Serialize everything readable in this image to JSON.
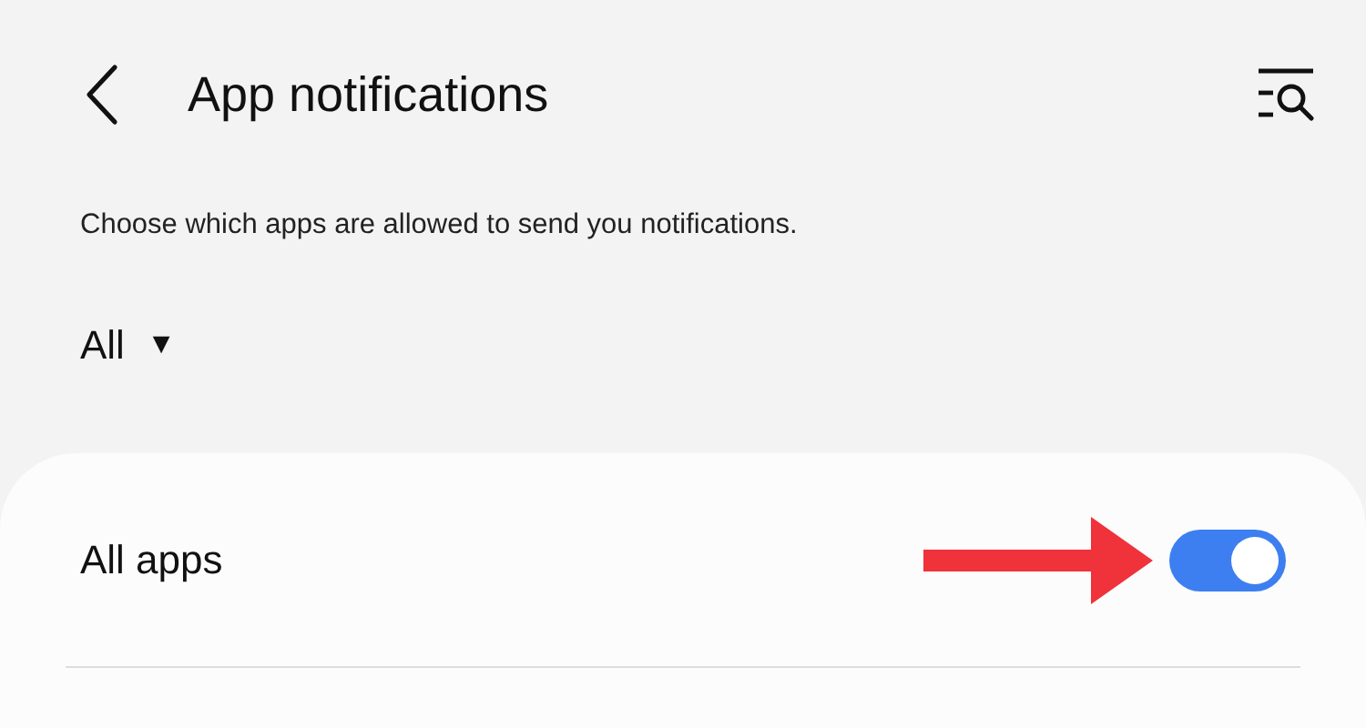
{
  "header": {
    "title": "App notifications"
  },
  "description": "Choose which apps are allowed to send you notifications.",
  "filter": {
    "label": "All",
    "caret": "▼"
  },
  "all_apps": {
    "label": "All apps",
    "on": true
  }
}
